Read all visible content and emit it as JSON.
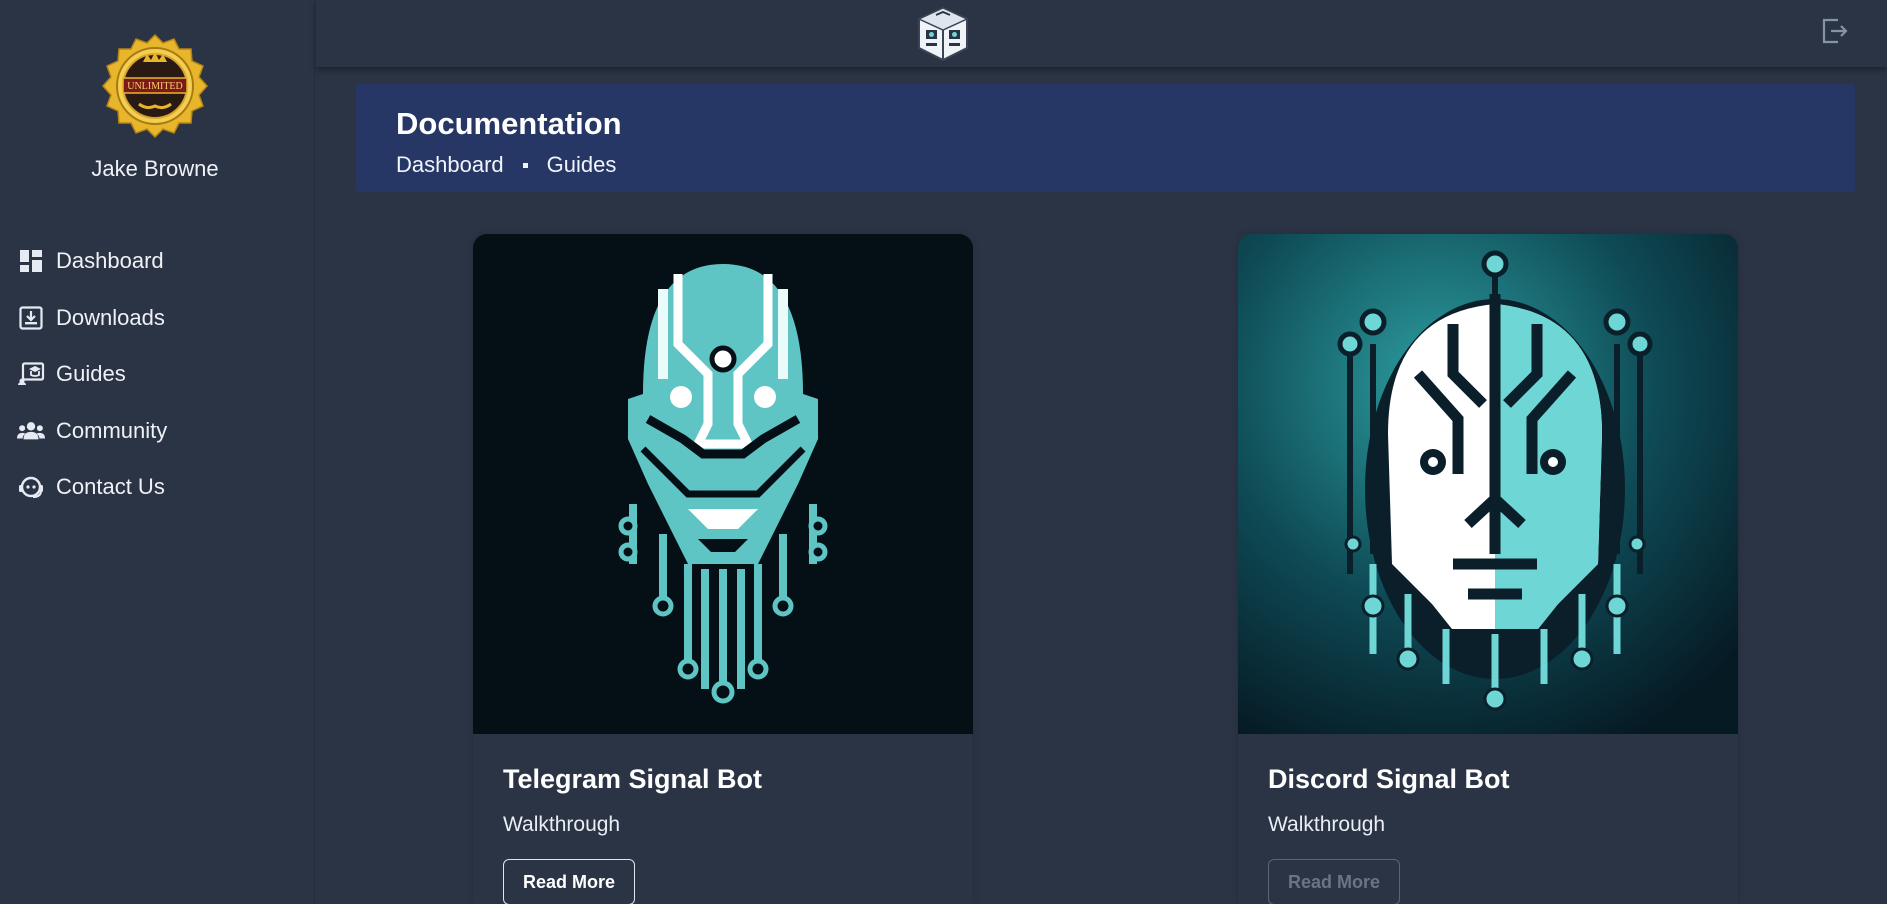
{
  "user": {
    "name": "Jake Browne",
    "badge_text": "UNLIMITED"
  },
  "sidebar": {
    "items": [
      {
        "label": "Dashboard",
        "icon": "dashboard-icon"
      },
      {
        "label": "Downloads",
        "icon": "download-icon"
      },
      {
        "label": "Guides",
        "icon": "guides-icon"
      },
      {
        "label": "Community",
        "icon": "community-icon"
      },
      {
        "label": "Contact Us",
        "icon": "support-icon"
      }
    ]
  },
  "topbar": {
    "logo_icon": "robot-cube-logo",
    "logout_icon": "logout-icon"
  },
  "header": {
    "title": "Documentation",
    "breadcrumb": [
      "Dashboard",
      "Guides"
    ]
  },
  "cards": [
    {
      "title": "Telegram Signal Bot",
      "subtitle": "Walkthrough",
      "button": "Read More",
      "button_state": "enabled"
    },
    {
      "title": "Discord Signal Bot",
      "subtitle": "Walkthrough",
      "button": "Read More",
      "button_state": "disabled"
    }
  ],
  "colors": {
    "background": "#2b3445",
    "header": "#263766",
    "accent_teal": "#6fd6d6",
    "badge_gold": "#e8b62c"
  }
}
